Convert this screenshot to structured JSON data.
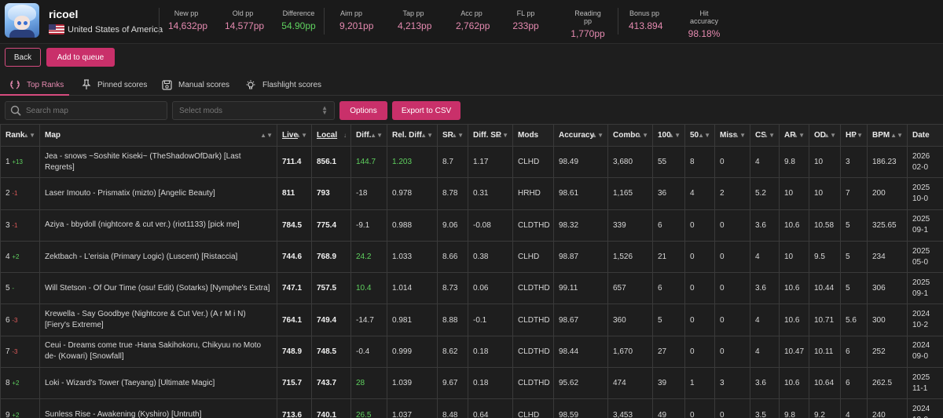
{
  "player": {
    "name": "ricoel",
    "country": "United States of America"
  },
  "stats": [
    {
      "label": "New pp",
      "value": "14,632pp"
    },
    {
      "label": "Old pp",
      "value": "14,577pp"
    },
    {
      "label": "Difference",
      "value": "54.90pp"
    },
    {
      "label": "Aim pp",
      "value": "9,201pp"
    },
    {
      "label": "Tap pp",
      "value": "4,213pp"
    },
    {
      "label": "Acc pp",
      "value": "2,762pp"
    },
    {
      "label": "FL pp",
      "value": "233pp"
    },
    {
      "label": "Reading pp",
      "value": "1,770pp"
    },
    {
      "label": "Bonus pp",
      "value": "413.894"
    },
    {
      "label": "Hit accuracy",
      "value": "98.18%"
    }
  ],
  "actions": {
    "back": "Back",
    "queue": "Add to queue"
  },
  "tabs": [
    "Top Ranks",
    "Pinned scores",
    "Manual scores",
    "Flashlight scores"
  ],
  "controls": {
    "search_placeholder": "Search map",
    "mods_placeholder": "Select mods",
    "options": "Options",
    "export": "Export to CSV"
  },
  "columns": [
    "Rank",
    "Map",
    "Live",
    "Local",
    "Diff.",
    "Rel. Diff.",
    "SR",
    "Diff. SR",
    "Mods",
    "Accuracy",
    "Combo",
    "100",
    "50",
    "Miss",
    "CS",
    "AR",
    "OD",
    "HP",
    "BPM",
    "Date"
  ],
  "rows": [
    {
      "rank": "1",
      "change": "+13",
      "map": "Jea - snows ~Soshite Kiseki~ (TheShadowOfDark) [Last Regrets]",
      "live": "711.4",
      "local": "856.1",
      "diff": "144.7",
      "rel": "1.203",
      "sr": "8.7",
      "dsr": "1.17",
      "mods": "CLHD",
      "acc": "98.49",
      "combo": "3,680",
      "c100": "55",
      "c50": "8",
      "miss": "0",
      "cs": "4",
      "ar": "9.8",
      "od": "10",
      "hp": "3",
      "bpm": "186.23",
      "date": "2026\n02-0"
    },
    {
      "rank": "2",
      "change": "-1",
      "map": "Laser Imouto - Prismatix (mizto) [Angelic Beauty]",
      "live": "811",
      "local": "793",
      "diff": "-18",
      "rel": "0.978",
      "sr": "8.78",
      "dsr": "0.31",
      "mods": "HRHD",
      "acc": "98.61",
      "combo": "1,165",
      "c100": "36",
      "c50": "4",
      "miss": "2",
      "cs": "5.2",
      "ar": "10",
      "od": "10",
      "hp": "7",
      "bpm": "200",
      "date": "2025\n10-0"
    },
    {
      "rank": "3",
      "change": "-1",
      "map": "Aziya - bbydoll (nightcore & cut ver.) (riot1133) [pick me]",
      "live": "784.5",
      "local": "775.4",
      "diff": "-9.1",
      "rel": "0.988",
      "sr": "9.06",
      "dsr": "-0.08",
      "mods": "CLDTHD",
      "acc": "98.32",
      "combo": "339",
      "c100": "6",
      "c50": "0",
      "miss": "0",
      "cs": "3.6",
      "ar": "10.6",
      "od": "10.58",
      "hp": "5",
      "bpm": "325.65",
      "date": "2025\n09-1"
    },
    {
      "rank": "4",
      "change": "+2",
      "map": "Zektbach - L'erisia (Primary Logic) (Luscent) [Ristaccia]",
      "live": "744.6",
      "local": "768.9",
      "diff": "24.2",
      "rel": "1.033",
      "sr": "8.66",
      "dsr": "0.38",
      "mods": "CLHD",
      "acc": "98.87",
      "combo": "1,526",
      "c100": "21",
      "c50": "0",
      "miss": "0",
      "cs": "4",
      "ar": "10",
      "od": "9.5",
      "hp": "5",
      "bpm": "234",
      "date": "2025\n05-0"
    },
    {
      "rank": "5",
      "change": "-",
      "map": "Will Stetson - Of Our Time (osu! Edit) (Sotarks) [Nymphe's Extra]",
      "live": "747.1",
      "local": "757.5",
      "diff": "10.4",
      "rel": "1.014",
      "sr": "8.73",
      "dsr": "0.06",
      "mods": "CLDTHD",
      "acc": "99.11",
      "combo": "657",
      "c100": "6",
      "c50": "0",
      "miss": "0",
      "cs": "3.6",
      "ar": "10.6",
      "od": "10.44",
      "hp": "5",
      "bpm": "306",
      "date": "2025\n09-1"
    },
    {
      "rank": "6",
      "change": "-3",
      "map": "Krewella - Say Goodbye (Nightcore & Cut Ver.) (A r M i N) [Fiery's Extreme]",
      "live": "764.1",
      "local": "749.4",
      "diff": "-14.7",
      "rel": "0.981",
      "sr": "8.88",
      "dsr": "-0.1",
      "mods": "CLDTHD",
      "acc": "98.67",
      "combo": "360",
      "c100": "5",
      "c50": "0",
      "miss": "0",
      "cs": "4",
      "ar": "10.6",
      "od": "10.71",
      "hp": "5.6",
      "bpm": "300",
      "date": "2024\n10-2"
    },
    {
      "rank": "7",
      "change": "-3",
      "map": "Ceui - Dreams come true -Hana Sakihokoru, Chikyuu no Moto de- (Kowari) [Snowfall]",
      "live": "748.9",
      "local": "748.5",
      "diff": "-0.4",
      "rel": "0.999",
      "sr": "8.62",
      "dsr": "0.18",
      "mods": "CLDTHD",
      "acc": "98.44",
      "combo": "1,670",
      "c100": "27",
      "c50": "0",
      "miss": "0",
      "cs": "4",
      "ar": "10.47",
      "od": "10.11",
      "hp": "6",
      "bpm": "252",
      "date": "2024\n09-0"
    },
    {
      "rank": "8",
      "change": "+2",
      "map": "Loki - Wizard's Tower (Taeyang) [Ultimate Magic]",
      "live": "715.7",
      "local": "743.7",
      "diff": "28",
      "rel": "1.039",
      "sr": "9.67",
      "dsr": "0.18",
      "mods": "CLDTHD",
      "acc": "95.62",
      "combo": "474",
      "c100": "39",
      "c50": "1",
      "miss": "3",
      "cs": "3.6",
      "ar": "10.6",
      "od": "10.64",
      "hp": "6",
      "bpm": "262.5",
      "date": "2025\n11-1"
    },
    {
      "rank": "9",
      "change": "+2",
      "map": "Sunless Rise - Awakening (Kyshiro) [Untruth]",
      "live": "713.6",
      "local": "740.1",
      "diff": "26.5",
      "rel": "1.037",
      "sr": "8.48",
      "dsr": "0.64",
      "mods": "CLHD",
      "acc": "98.59",
      "combo": "3,453",
      "c100": "49",
      "c50": "0",
      "miss": "0",
      "cs": "3.5",
      "ar": "9.8",
      "od": "9.2",
      "hp": "4",
      "bpm": "240",
      "date": "2024\n12-0"
    }
  ]
}
